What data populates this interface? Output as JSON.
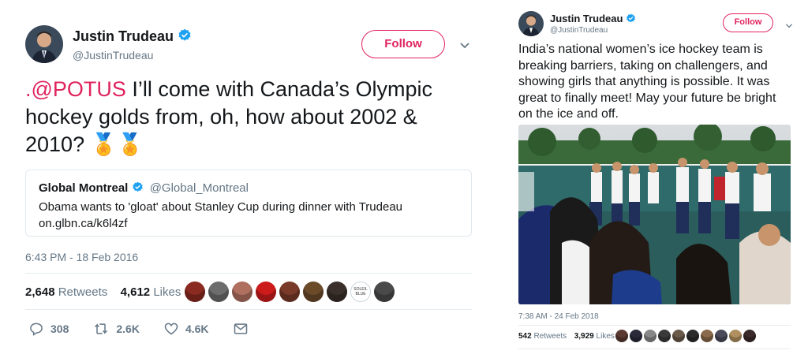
{
  "tweet1": {
    "author_name": "Justin Trudeau",
    "handle": "@JustinTrudeau",
    "follow_label": "Follow",
    "text_mention": ".@POTUS",
    "text_rest": " I’ll come with Canada’s Olympic hockey golds from, oh, how about 2002 & 2010? 🏅🏅",
    "quote": {
      "name": "Global Montreal",
      "handle": "@Global_Montreal",
      "text": "Obama wants to 'gloat' about Stanley Cup during dinner with Trudeau",
      "link": "on.glbn.ca/k6l4zf"
    },
    "timestamp": "6:43 PM - 18 Feb 2016",
    "retweets_count": "2,648",
    "retweets_label": "Retweets",
    "likes_count": "4,612",
    "likes_label": "Likes",
    "liker_badge_text": "SOLEIL BLUE",
    "replies": "308",
    "retweets_short": "2.6K",
    "likes_short": "4.6K",
    "likers": [
      "#8a2a20",
      "#6d6d6d",
      "#b07060",
      "#cc1b1b",
      "#7a3a2a",
      "#6b4a2a",
      "#3a2f2a",
      "#ffffff",
      "#4a4a4a"
    ]
  },
  "tweet2": {
    "author_name": "Justin Trudeau",
    "handle": "@JustinTrudeau",
    "follow_label": "Follow",
    "text": "India’s national women’s ice hockey team is breaking barriers, taking on challengers, and showing girls that anything is possible. It was great to finally meet! May your future be bright on the ice and off.",
    "timestamp": "7:38 AM - 24 Feb 2018",
    "retweets_count": "542",
    "retweets_label": "Retweets",
    "likes_count": "3,929",
    "likes_label": "Likes",
    "likers": [
      "#5a3a30",
      "#2a2a3a",
      "#888888",
      "#3a3a3a",
      "#6a5a4a",
      "#2a2a2a",
      "#8a6a4a",
      "#4a4a5a",
      "#b09060",
      "#3a2a2a"
    ]
  },
  "colors": {
    "accent": "#e0245e",
    "verified": "#1da1f2",
    "muted": "#657786"
  }
}
